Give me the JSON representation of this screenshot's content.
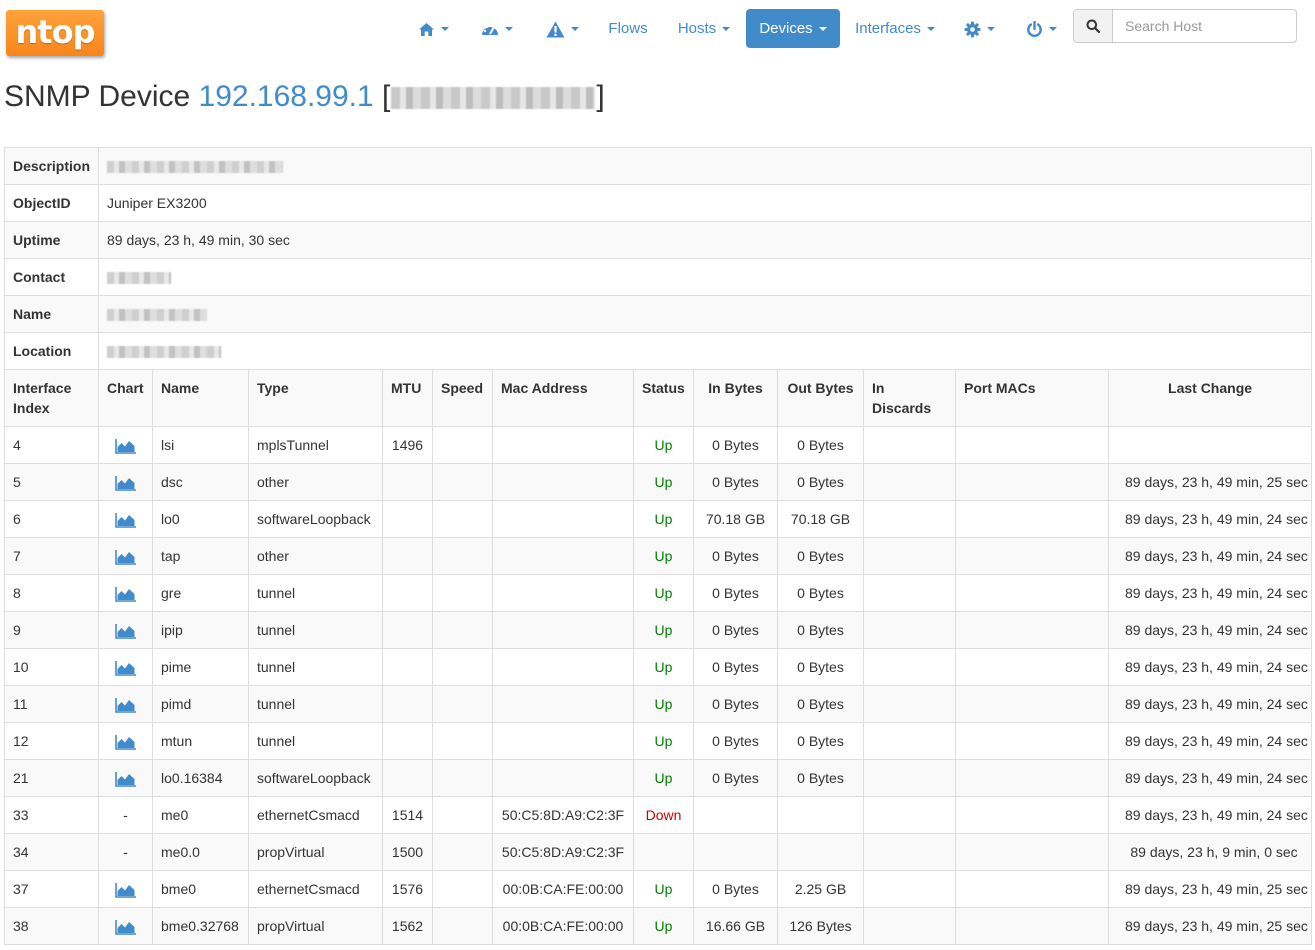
{
  "navbar": {
    "logo": "ntop",
    "items": [
      {
        "label": "",
        "icon": "home-icon",
        "dropdown": true
      },
      {
        "label": "",
        "icon": "dashboard-icon",
        "dropdown": true
      },
      {
        "label": "",
        "icon": "alert-icon",
        "dropdown": true
      },
      {
        "label": "Flows",
        "dropdown": false
      },
      {
        "label": "Hosts",
        "dropdown": true
      },
      {
        "label": "Devices",
        "dropdown": true,
        "active": true
      },
      {
        "label": "Interfaces",
        "dropdown": true
      },
      {
        "label": "",
        "icon": "gear-icon",
        "dropdown": true
      },
      {
        "label": "",
        "icon": "power-icon",
        "dropdown": true
      }
    ],
    "search_placeholder": "Search Host"
  },
  "title": {
    "prefix": "SNMP Device",
    "ip": "192.168.99.1",
    "open_bracket": "[",
    "close_bracket": "]"
  },
  "device_info": {
    "description_label": "Description",
    "objectid_label": "ObjectID",
    "objectid_value": "Juniper EX3200",
    "uptime_label": "Uptime",
    "uptime_value": "89 days, 23 h, 49 min, 30 sec",
    "contact_label": "Contact",
    "name_label": "Name",
    "location_label": "Location"
  },
  "interfaces": {
    "headers": {
      "index": "Interface Index",
      "chart": "Chart",
      "name": "Name",
      "type": "Type",
      "mtu": "MTU",
      "speed": "Speed",
      "mac": "Mac Address",
      "status": "Status",
      "in_bytes": "In Bytes",
      "out_bytes": "Out Bytes",
      "in_discards": "In Discards",
      "port_macs": "Port MACs",
      "last_change": "Last Change"
    },
    "rows": [
      {
        "index": "4",
        "chart": true,
        "name": "lsi",
        "type": "mplsTunnel",
        "mtu": "1496",
        "speed": "",
        "mac": "",
        "status": "Up",
        "in_bytes": "0 Bytes",
        "out_bytes": "0 Bytes",
        "in_discards": "",
        "port_macs": "",
        "last_change": ""
      },
      {
        "index": "5",
        "chart": true,
        "name": "dsc",
        "type": "other",
        "mtu": "",
        "speed": "",
        "mac": "",
        "status": "Up",
        "in_bytes": "0 Bytes",
        "out_bytes": "0 Bytes",
        "in_discards": "",
        "port_macs": "",
        "last_change": "89 days, 23 h, 49 min, 25 sec"
      },
      {
        "index": "6",
        "chart": true,
        "name": "lo0",
        "type": "softwareLoopback",
        "mtu": "",
        "speed": "",
        "mac": "",
        "status": "Up",
        "in_bytes": "70.18 GB",
        "out_bytes": "70.18 GB",
        "in_discards": "",
        "port_macs": "",
        "last_change": "89 days, 23 h, 49 min, 24 sec"
      },
      {
        "index": "7",
        "chart": true,
        "name": "tap",
        "type": "other",
        "mtu": "",
        "speed": "",
        "mac": "",
        "status": "Up",
        "in_bytes": "0 Bytes",
        "out_bytes": "0 Bytes",
        "in_discards": "",
        "port_macs": "",
        "last_change": "89 days, 23 h, 49 min, 24 sec"
      },
      {
        "index": "8",
        "chart": true,
        "name": "gre",
        "type": "tunnel",
        "mtu": "",
        "speed": "",
        "mac": "",
        "status": "Up",
        "in_bytes": "0 Bytes",
        "out_bytes": "0 Bytes",
        "in_discards": "",
        "port_macs": "",
        "last_change": "89 days, 23 h, 49 min, 24 sec"
      },
      {
        "index": "9",
        "chart": true,
        "name": "ipip",
        "type": "tunnel",
        "mtu": "",
        "speed": "",
        "mac": "",
        "status": "Up",
        "in_bytes": "0 Bytes",
        "out_bytes": "0 Bytes",
        "in_discards": "",
        "port_macs": "",
        "last_change": "89 days, 23 h, 49 min, 24 sec"
      },
      {
        "index": "10",
        "chart": true,
        "name": "pime",
        "type": "tunnel",
        "mtu": "",
        "speed": "",
        "mac": "",
        "status": "Up",
        "in_bytes": "0 Bytes",
        "out_bytes": "0 Bytes",
        "in_discards": "",
        "port_macs": "",
        "last_change": "89 days, 23 h, 49 min, 24 sec"
      },
      {
        "index": "11",
        "chart": true,
        "name": "pimd",
        "type": "tunnel",
        "mtu": "",
        "speed": "",
        "mac": "",
        "status": "Up",
        "in_bytes": "0 Bytes",
        "out_bytes": "0 Bytes",
        "in_discards": "",
        "port_macs": "",
        "last_change": "89 days, 23 h, 49 min, 24 sec"
      },
      {
        "index": "12",
        "chart": true,
        "name": "mtun",
        "type": "tunnel",
        "mtu": "",
        "speed": "",
        "mac": "",
        "status": "Up",
        "in_bytes": "0 Bytes",
        "out_bytes": "0 Bytes",
        "in_discards": "",
        "port_macs": "",
        "last_change": "89 days, 23 h, 49 min, 24 sec"
      },
      {
        "index": "21",
        "chart": true,
        "name": "lo0.16384",
        "type": "softwareLoopback",
        "mtu": "",
        "speed": "",
        "mac": "",
        "status": "Up",
        "in_bytes": "0 Bytes",
        "out_bytes": "0 Bytes",
        "in_discards": "",
        "port_macs": "",
        "last_change": "89 days, 23 h, 49 min, 24 sec"
      },
      {
        "index": "33",
        "chart": false,
        "chart_text": "-",
        "name": "me0",
        "type": "ethernetCsmacd",
        "mtu": "1514",
        "speed": "",
        "mac": "50:C5:8D:A9:C2:3F",
        "status": "Down",
        "in_bytes": "",
        "out_bytes": "",
        "in_discards": "",
        "port_macs": "",
        "last_change": "89 days, 23 h, 49 min, 24 sec"
      },
      {
        "index": "34",
        "chart": false,
        "chart_text": "-",
        "name": "me0.0",
        "type": "propVirtual",
        "mtu": "1500",
        "speed": "",
        "mac": "50:C5:8D:A9:C2:3F",
        "status": "",
        "in_bytes": "",
        "out_bytes": "",
        "in_discards": "",
        "port_macs": "",
        "last_change": "89 days, 23 h, 9 min, 0 sec"
      },
      {
        "index": "37",
        "chart": true,
        "name": "bme0",
        "type": "ethernetCsmacd",
        "mtu": "1576",
        "speed": "",
        "mac": "00:0B:CA:FE:00:00",
        "status": "Up",
        "in_bytes": "0 Bytes",
        "out_bytes": "2.25 GB",
        "in_discards": "",
        "port_macs": "",
        "last_change": "89 days, 23 h, 49 min, 25 sec"
      },
      {
        "index": "38",
        "chart": true,
        "name": "bme0.32768",
        "type": "propVirtual",
        "mtu": "1562",
        "speed": "",
        "mac": "00:0B:CA:FE:00:00",
        "status": "Up",
        "in_bytes": "16.66 GB",
        "out_bytes": "126 Bytes",
        "in_discards": "",
        "port_macs": "",
        "last_change": "89 days, 23 h, 49 min, 25 sec"
      }
    ]
  },
  "colors": {
    "accent": "#428bca",
    "logo": "#f7861c",
    "status_up": "#008000",
    "status_down": "#d00000"
  }
}
